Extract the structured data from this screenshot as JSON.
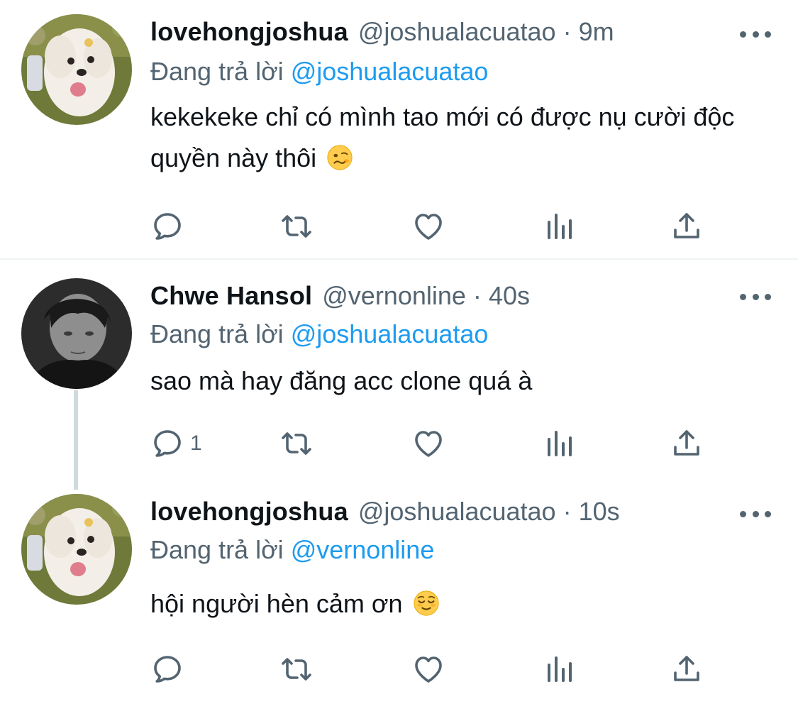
{
  "colors": {
    "link": "#1d9bf0",
    "secondary": "#536471",
    "text": "#0f1419",
    "divider": "#eff3f4",
    "thread": "#cfd9de"
  },
  "tweets": [
    {
      "name": "lovehongjoshua",
      "handle": "@joshualacuatao",
      "separator": "·",
      "time": "9m",
      "replying_label": "Đang trả lời",
      "replying_to": "@joshualacuatao",
      "text": "kekekeke chỉ có mình tao mới có được nụ cười độc quyền này thôi",
      "emoji": "woozy-face-emoji",
      "reply_count": ""
    },
    {
      "name": "Chwe Hansol",
      "handle": "@vernonline",
      "separator": "·",
      "time": "40s",
      "replying_label": "Đang trả lời",
      "replying_to": "@joshualacuatao",
      "text": "sao mà hay đăng acc clone quá à",
      "emoji": "",
      "reply_count": "1"
    },
    {
      "name": "lovehongjoshua",
      "handle": "@joshualacuatao",
      "separator": "·",
      "time": "10s",
      "replying_label": "Đang trả lời",
      "replying_to": "@vernonline",
      "text": "hội người hèn cảm ơn",
      "emoji": "relieved-face-emoji",
      "reply_count": ""
    }
  ],
  "icons": [
    "reply-icon",
    "retweet-icon",
    "like-icon",
    "views-icon",
    "share-icon",
    "more-icon"
  ]
}
